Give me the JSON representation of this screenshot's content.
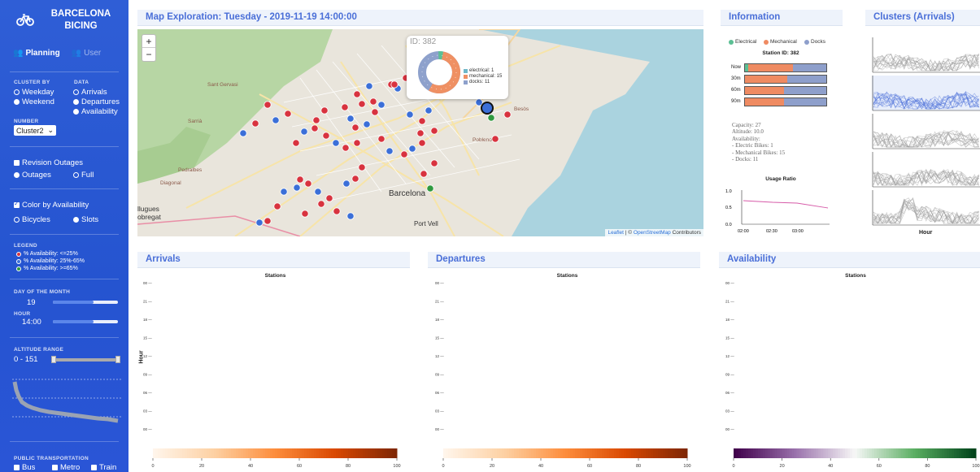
{
  "sidebar": {
    "brand": "BARCELONA\nBICING",
    "tabs": [
      {
        "label": "Planning"
      },
      {
        "label": "User"
      }
    ],
    "cluster_by": {
      "label": "CLUSTER BY",
      "options": [
        "Weekday",
        "Weekend"
      ],
      "selected": "Weekday"
    },
    "data": {
      "label": "DATA",
      "options": [
        "Arrivals",
        "Departures",
        "Availability"
      ],
      "selected": "Departures"
    },
    "number": {
      "label": "NUMBER",
      "value": "Cluster2"
    },
    "revision": {
      "label": "Revision Outages",
      "checked": false,
      "options": [
        "Outages",
        "Full"
      ]
    },
    "color_by": {
      "label": "Color by Availability",
      "checked": true,
      "options": [
        "Bicycles",
        "Slots"
      ]
    },
    "legend": {
      "label": "LEGEND",
      "items": [
        {
          "text": "% Availability: <=25%",
          "color": "#d8333f"
        },
        {
          "text": "% Availability: 25%-65%",
          "color": "#3b6fd8"
        },
        {
          "text": "% Availability: >=65%",
          "color": "#2f9a3f"
        }
      ]
    },
    "day": {
      "label": "DAY OF THE MONTH",
      "value": "19",
      "fraction": 0.6
    },
    "hour": {
      "label": "HOUR",
      "value": "14:00",
      "fraction": 0.6
    },
    "altitude": {
      "label": "ALTITUDE RANGE",
      "value": "0 - 151"
    },
    "public_transport": {
      "label": "PUBLIC TRANSPORTATION",
      "options": [
        "Bus",
        "Metro",
        "Train"
      ]
    }
  },
  "map": {
    "title": "Map Exploration: Tuesday - 2019-11-19 14:00:00",
    "zoom_in": "+",
    "zoom_out": "−",
    "attribution": {
      "leaflet": "Leaflet",
      "sep": " | © ",
      "osm": "OpenStreetMap",
      "rest": " Contributors"
    },
    "labels": [
      {
        "text": "Barcelona",
        "big": true
      },
      {
        "text": "Port Vell",
        "big": true
      },
      {
        "text": "Sant Gervasi",
        "big": false
      },
      {
        "text": "Sarrià",
        "big": false
      },
      {
        "text": "Pedralbes",
        "big": false
      },
      {
        "text": "Diagonal",
        "big": false
      },
      {
        "text": "Besòs",
        "big": false
      },
      {
        "text": "Poblenou",
        "big": false
      },
      {
        "text": "llugues\nobregat",
        "big": true
      }
    ],
    "popup": {
      "id": "ID: 382",
      "items": [
        {
          "text": "electrical: 1",
          "color": "#6fb8c9"
        },
        {
          "text": "mechanical: 15",
          "color": "#ef9063"
        },
        {
          "text": "docks: 11",
          "color": "#8ea1cc"
        }
      ]
    }
  },
  "info": {
    "title": "Information",
    "legend": [
      {
        "label": "Electrical",
        "color": "#5bbf94"
      },
      {
        "label": "Mechanical",
        "color": "#ef8b62"
      },
      {
        "label": "Docks",
        "color": "#8e9fcb"
      }
    ],
    "station_title": "Station ID: 382",
    "bars": [
      {
        "label": "Now",
        "electrical": 1,
        "mechanical": 15,
        "docks": 11
      },
      {
        "label": "30m",
        "electrical": 0,
        "mechanical": 14,
        "docks": 13
      },
      {
        "label": "60m",
        "electrical": 0,
        "mechanical": 13,
        "docks": 14
      },
      {
        "label": "90m",
        "electrical": 0,
        "mechanical": 13,
        "docks": 14
      }
    ],
    "details": "Capacity: 27\nAltitude: 10.0\nAvailability:\n- Electric Bikes: 1\n- Mechanical Bikes: 15\n- Docks: 11",
    "usage_title": "Usage Ratio",
    "usage_y_ticks": [
      "1.0",
      "0.5",
      "0.0"
    ],
    "usage_x_ticks": [
      "02:00",
      "02:30",
      "03:00"
    ]
  },
  "clusters": {
    "title": "Clusters (Arrivals)",
    "xlabel": "Hour"
  },
  "heatmaps": [
    {
      "title": "Arrivals",
      "subtitle": "Stations",
      "ylabel": "Hour",
      "palette": "orange"
    },
    {
      "title": "Departures",
      "subtitle": "Stations",
      "ylabel": "",
      "palette": "orange"
    },
    {
      "title": "Availability",
      "subtitle": "Stations",
      "ylabel": "",
      "palette": "prgn"
    }
  ],
  "heatmap_y_ticks": [
    "00",
    "21",
    "18",
    "15",
    "12",
    "09",
    "06",
    "03",
    "00"
  ],
  "colorbar_ticks": [
    "0",
    "20",
    "40",
    "60",
    "80",
    "100"
  ],
  "colors": {
    "accent": "#4a6fd8",
    "sidebar": "#2554d0",
    "red": "#d8333f",
    "blue": "#3b6fd8",
    "green": "#2f9a3f"
  }
}
